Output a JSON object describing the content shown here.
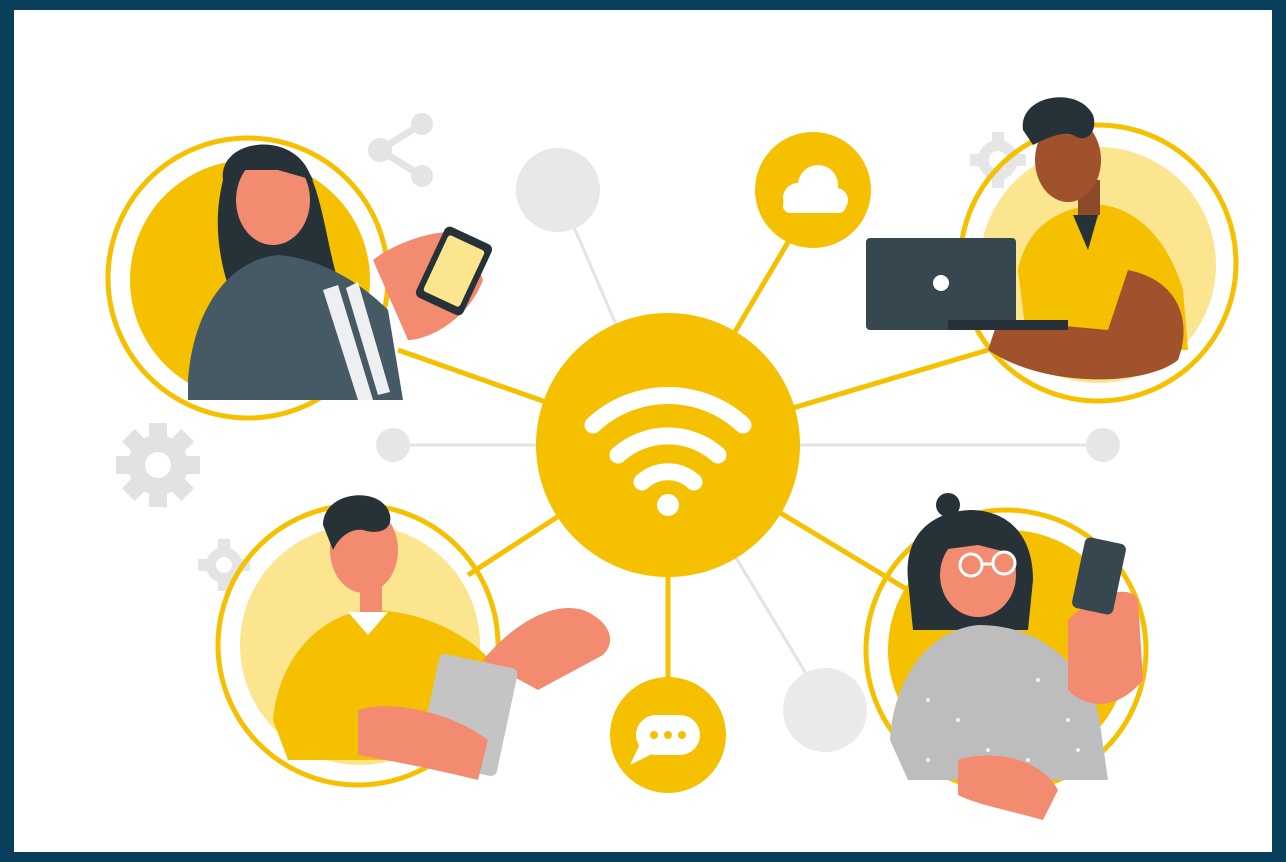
{
  "illustration": {
    "theme": "wireless network connecting people",
    "palette": {
      "frame": "#0a3f5c",
      "background": "#ffffff",
      "accent": "#f5c000",
      "accent_light": "#fbe58f",
      "lines": "#e0e0e0",
      "dark_clothing": "#37474f",
      "skin": "#f28b70",
      "skin_dark": "#a0522d"
    },
    "hub_icon": "wifi-icon",
    "satellite_icons": [
      "cloud-icon",
      "chat-bubble-icon",
      "share-icon",
      "gear-icon"
    ],
    "people": [
      {
        "id": "woman-with-phone",
        "device": "smartphone"
      },
      {
        "id": "man-with-laptop",
        "device": "laptop"
      },
      {
        "id": "man-with-tablet",
        "device": "tablet"
      },
      {
        "id": "woman-with-glasses-phone",
        "device": "smartphone"
      }
    ]
  }
}
